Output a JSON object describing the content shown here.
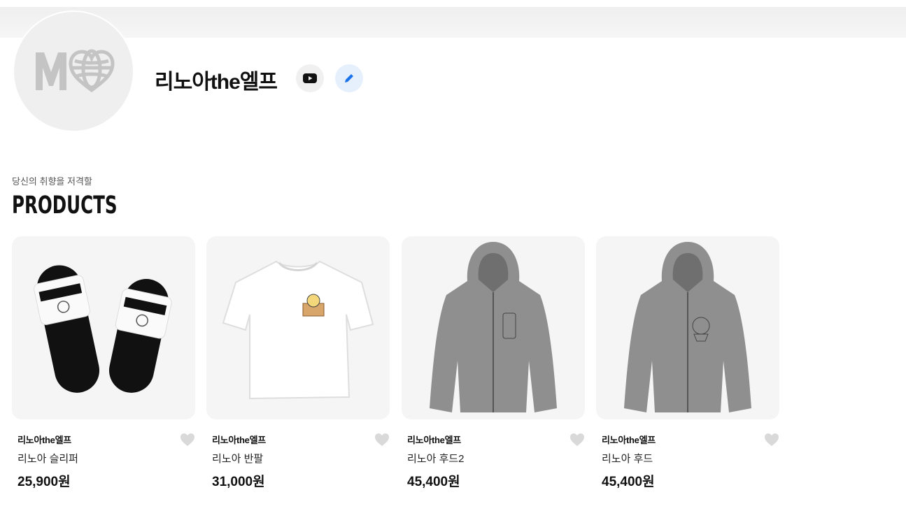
{
  "shop": {
    "name": "리노아the엘프",
    "tagline": "당신의 취향을 저격할",
    "section_title": "PRODUCTS"
  },
  "icons": {
    "youtube": "youtube-icon",
    "edit": "pencil-icon",
    "wishlist": "heart-icon"
  },
  "colors": {
    "edit_accent": "#1a73e8",
    "heart": "#d9d9d9"
  },
  "products": [
    {
      "shop": "리노아the엘프",
      "name": "리노아 슬리퍼",
      "price": "25,900원"
    },
    {
      "shop": "리노아the엘프",
      "name": "리노아 반팔",
      "price": "31,000원"
    },
    {
      "shop": "리노아the엘프",
      "name": "리노아 후드2",
      "price": "45,400원"
    },
    {
      "shop": "리노아the엘프",
      "name": "리노아 후드",
      "price": "45,400원"
    }
  ]
}
